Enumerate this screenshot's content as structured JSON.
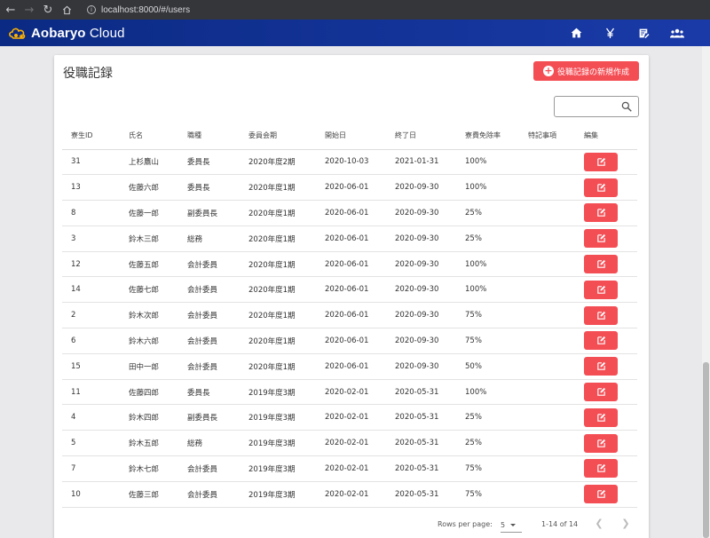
{
  "browser": {
    "url": "localhost:8000/#/users"
  },
  "app": {
    "brand_bold": "Aobaryo",
    "brand_rest": " Cloud"
  },
  "page": {
    "title": "役職記録",
    "new_button": "役職記録の新規作成",
    "search": {
      "value": "",
      "placeholder": ""
    }
  },
  "table": {
    "headers": [
      "寮生ID",
      "氏名",
      "職種",
      "委員会期",
      "開始日",
      "終了日",
      "寮費免除率",
      "特記事項",
      "編集"
    ],
    "rows": [
      [
        "31",
        "上杉鷹山",
        "委員長",
        "2020年度2期",
        "2020-10-03",
        "2021-01-31",
        "100%",
        ""
      ],
      [
        "13",
        "佐藤六郎",
        "委員長",
        "2020年度1期",
        "2020-06-01",
        "2020-09-30",
        "100%",
        ""
      ],
      [
        "8",
        "佐藤一郎",
        "副委員長",
        "2020年度1期",
        "2020-06-01",
        "2020-09-30",
        "25%",
        ""
      ],
      [
        "3",
        "鈴木三郎",
        "総務",
        "2020年度1期",
        "2020-06-01",
        "2020-09-30",
        "25%",
        ""
      ],
      [
        "12",
        "佐藤五郎",
        "会計委員",
        "2020年度1期",
        "2020-06-01",
        "2020-09-30",
        "100%",
        ""
      ],
      [
        "14",
        "佐藤七郎",
        "会計委員",
        "2020年度1期",
        "2020-06-01",
        "2020-09-30",
        "100%",
        ""
      ],
      [
        "2",
        "鈴木次郎",
        "会計委員",
        "2020年度1期",
        "2020-06-01",
        "2020-09-30",
        "75%",
        ""
      ],
      [
        "6",
        "鈴木六郎",
        "会計委員",
        "2020年度1期",
        "2020-06-01",
        "2020-09-30",
        "75%",
        ""
      ],
      [
        "15",
        "田中一郎",
        "会計委員",
        "2020年度1期",
        "2020-06-01",
        "2020-09-30",
        "50%",
        ""
      ],
      [
        "11",
        "佐藤四郎",
        "委員長",
        "2019年度3期",
        "2020-02-01",
        "2020-05-31",
        "100%",
        ""
      ],
      [
        "4",
        "鈴木四郎",
        "副委員長",
        "2019年度3期",
        "2020-02-01",
        "2020-05-31",
        "25%",
        ""
      ],
      [
        "5",
        "鈴木五郎",
        "総務",
        "2019年度3期",
        "2020-02-01",
        "2020-05-31",
        "25%",
        ""
      ],
      [
        "7",
        "鈴木七郎",
        "会計委員",
        "2019年度3期",
        "2020-02-01",
        "2020-05-31",
        "75%",
        ""
      ],
      [
        "10",
        "佐藤三郎",
        "会計委員",
        "2019年度3期",
        "2020-02-01",
        "2020-05-31",
        "75%",
        ""
      ]
    ]
  },
  "pagination": {
    "rows_per_page_label": "Rows per page:",
    "rows_per_page": "5",
    "range": "1-14 of 14"
  },
  "colors": {
    "accent": "#f44e55",
    "appbar": "#0b2a83"
  }
}
